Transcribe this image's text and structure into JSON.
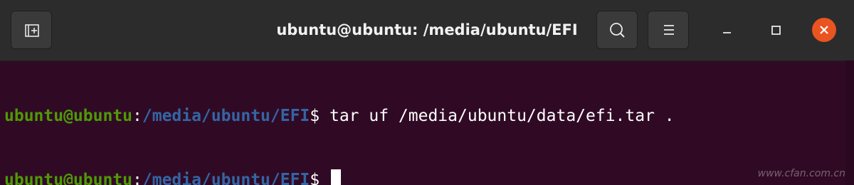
{
  "window": {
    "title": "ubuntu@ubuntu: /media/ubuntu/EFI"
  },
  "toolbar": {
    "new_tab_icon": "new-tab-icon",
    "search_icon": "search-icon",
    "menu_icon": "hamburger-menu-icon",
    "minimize_icon": "minimize-icon",
    "maximize_icon": "maximize-icon",
    "close_icon": "close-icon"
  },
  "colors": {
    "terminal_bg": "#300a24",
    "titlebar_bg": "#2c2c2c",
    "prompt_user": "#4e9a06",
    "prompt_path": "#3465a4",
    "close_button": "#e95420"
  },
  "terminal": {
    "lines": [
      {
        "user": "ubuntu@ubuntu",
        "sep": ":",
        "path": "/media/ubuntu/EFI",
        "symbol": "$",
        "command": " tar uf /media/ubuntu/data/efi.tar ."
      },
      {
        "user": "ubuntu@ubuntu",
        "sep": ":",
        "path": "/media/ubuntu/EFI",
        "symbol": "$",
        "command": " "
      }
    ]
  },
  "watermark": {
    "text": "www.cfan.com.cn"
  }
}
